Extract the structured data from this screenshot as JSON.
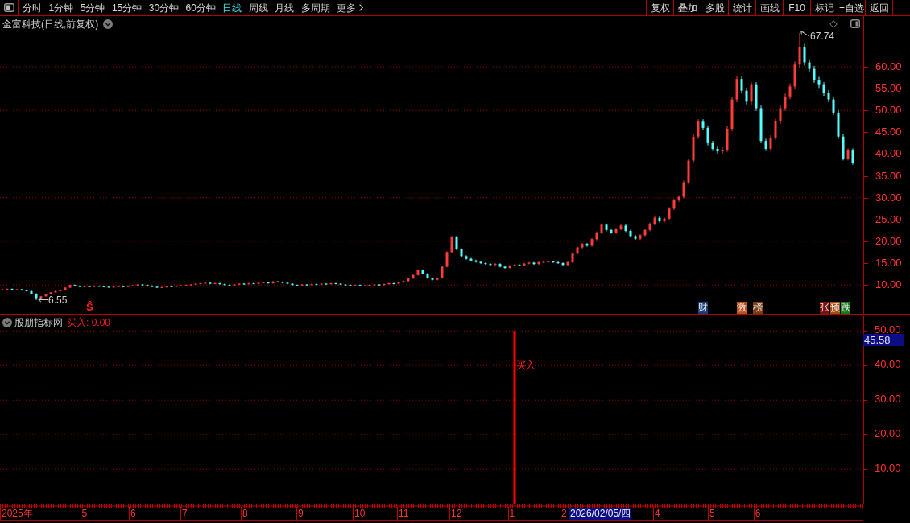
{
  "toolbar": {
    "periods": [
      {
        "label": "分时",
        "selected": false
      },
      {
        "label": "1分钟",
        "selected": false
      },
      {
        "label": "5分钟",
        "selected": false
      },
      {
        "label": "15分钟",
        "selected": false
      },
      {
        "label": "30分钟",
        "selected": false
      },
      {
        "label": "60分钟",
        "selected": false
      },
      {
        "label": "日线",
        "selected": true
      },
      {
        "label": "周线",
        "selected": false
      },
      {
        "label": "月线",
        "selected": false
      },
      {
        "label": "多周期",
        "selected": false
      }
    ],
    "more": "更多",
    "buttons": [
      "复权",
      "叠加",
      "多股",
      "统计",
      "画线",
      "F10",
      "标记",
      "+自选",
      "返回"
    ]
  },
  "main_chart": {
    "title": "金富科技(日线,前复权)",
    "price_axis": [
      "60.00",
      "55.00",
      "50.00",
      "45.00",
      "40.00",
      "35.00",
      "30.00",
      "25.00",
      "20.00",
      "15.00",
      "10.00"
    ],
    "high_label": "67.74",
    "low_label": "6.55",
    "signal_marker": "Ŝ",
    "events": [
      {
        "label": "财",
        "color": "#1a3c78"
      },
      {
        "label": "激",
        "color": "#c0501a"
      },
      {
        "label": "榜",
        "color": "#7a3c10"
      },
      {
        "label": "张",
        "color": "#7a1010"
      },
      {
        "label": "预",
        "color": "#a84c10"
      },
      {
        "label": "跌",
        "color": "#1a7a1a"
      }
    ]
  },
  "indicator": {
    "name": "股朋指标网",
    "reading": "买入: 0.00",
    "cursor_value": "45.58",
    "chart_data": {
      "type": "bar",
      "values": [
        50
      ],
      "ylim": [
        -0.2,
        54.7
      ],
      "yticks": [
        {
          "value": 50,
          "label": "50.00"
        },
        {
          "value": 40,
          "label": "40.00"
        },
        {
          "value": 30,
          "label": "30.00"
        },
        {
          "value": 20,
          "label": "20.00"
        },
        {
          "value": 10,
          "label": "10.00"
        }
      ],
      "grid": true,
      "annotations": [
        "买入"
      ]
    }
  },
  "time_axis": [
    "2025年",
    "5",
    "6",
    "7",
    "8",
    "9",
    "10",
    "11",
    "12",
    "1",
    "2",
    "4",
    "5",
    "6"
  ],
  "cursor_date": "2026/02/05/四"
}
